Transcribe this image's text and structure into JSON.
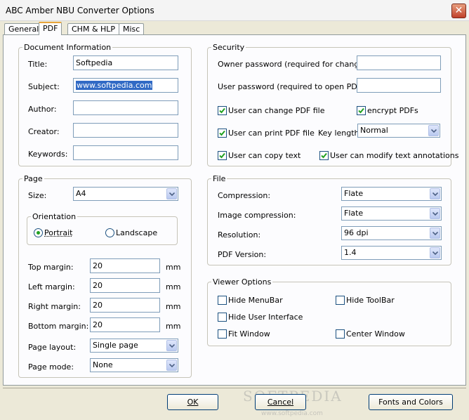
{
  "window": {
    "title": "ABC Amber NBU Converter Options",
    "close_glyph": "✕"
  },
  "tabs": [
    {
      "label": "General"
    },
    {
      "label": "PDF"
    },
    {
      "label": "CHM & HLP"
    },
    {
      "label": "Misc"
    }
  ],
  "document_info": {
    "title": "Document Information",
    "fields": [
      {
        "label": "Title:",
        "value": "Softpedia"
      },
      {
        "label": "Subject:",
        "value": "www.softpedia.com"
      },
      {
        "label": "Author:",
        "value": ""
      },
      {
        "label": "Creator:",
        "value": ""
      },
      {
        "label": "Keywords:",
        "value": ""
      }
    ]
  },
  "security": {
    "title": "Security",
    "owner_password_label": "Owner password (required for changes):",
    "owner_password_value": "",
    "user_password_label": "User password (required to open PDF):",
    "user_password_value": "",
    "change_pdf_label": "User can change PDF file",
    "change_pdf_checked": true,
    "encrypt_label": "encrypt PDFs",
    "encrypt_checked": true,
    "print_label": "User can print PDF file",
    "print_checked": true,
    "key_length_label": "Key length:",
    "key_length_value": "Normal",
    "copy_label": "User can copy text",
    "copy_checked": true,
    "annot_label": "User can modify text annotations",
    "annot_checked": true
  },
  "page": {
    "title": "Page",
    "size_label": "Size:",
    "size_value": "A4",
    "orientation_title": "Orientation",
    "portrait_label": "Portrait",
    "landscape_label": "Landscape",
    "selected_orientation": "portrait",
    "margins": [
      {
        "label": "Top margin:",
        "value": "20",
        "unit": "mm"
      },
      {
        "label": "Left margin:",
        "value": "20",
        "unit": "mm"
      },
      {
        "label": "Right margin:",
        "value": "20",
        "unit": "mm"
      },
      {
        "label": "Bottom margin:",
        "value": "20",
        "unit": "mm"
      }
    ],
    "layout_label": "Page layout:",
    "layout_value": "Single page",
    "mode_label": "Page mode:",
    "mode_value": "None"
  },
  "file": {
    "title": "File",
    "compression_label": "Compression:",
    "compression_value": "Flate",
    "image_compression_label": "Image compression:",
    "image_compression_value": "Flate",
    "resolution_label": "Resolution:",
    "resolution_value": "96 dpi",
    "version_label": "PDF Version:",
    "version_value": "1.4"
  },
  "viewer": {
    "title": "Viewer Options",
    "hide_menubar_label": "Hide MenuBar",
    "hide_toolbar_label": "Hide ToolBar",
    "hide_ui_label": "Hide User Interface",
    "fit_window_label": "Fit Window",
    "center_window_label": "Center Window"
  },
  "buttons": {
    "ok_label": "OK",
    "cancel_label": "Cancel",
    "fonts_label": "Fonts and Colors"
  },
  "watermark": {
    "text": "SOFTPEDIA",
    "url": "www.softpedia.com"
  },
  "colors": {
    "selection": "#316ac5",
    "check": "#21a121",
    "tab_accent": "#e8a53b"
  }
}
